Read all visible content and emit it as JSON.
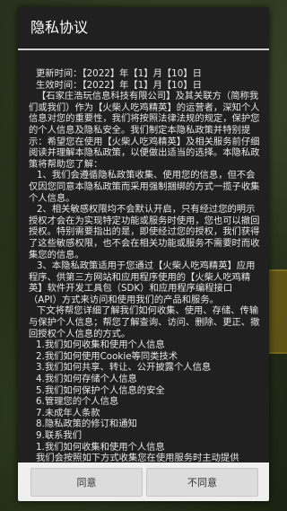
{
  "dialog": {
    "title": "隐私协议",
    "updated": "更新时间：【2022】年【1】月【10】日",
    "effective": "生效时间：【2022】年【1】月【10】日",
    "intro": "【石家庄浩玩信息科技有限公司】及其关联方（简称我们或我们）作为【火柴人吃鸡精英】的运营者，深知个人信息对您的重要性，我们将按照法律法规的规定，保护您的个人信息及隐私安全。我们制定本隐私政策并特别提示：希望您在使用【火柴人吃鸡精英】及相关服务前仔细阅读并理解本隐私政策，以便做出适当的选择。本隐私政策将帮助您了解：",
    "point1": "1、我们会遵循隐私政策收集、使用您的信息，但不会仅因您同意本隐私政策而采用强制捆绑的方式一揽子收集个人信息。",
    "point2": "2、相关敏感权限均不会默认开启，只有经过您的明示授权才会在为实现特定功能或服务时使用，您也可以撤回授权。特别需要指出的是，即使经过您的授权，我们获得了这些敏感权限，也不会在相关功能或服务不需要时而收集您的信息。",
    "point3": "3、本隐私政策适用于您通过【火柴人吃鸡精英】应用程序、供第三方网站和应用程序使用的【火柴人吃鸡精英】软件开发工具包（SDK）和应用程序编程接口（API）方式来访问和使用我们的产品和服务。",
    "toc_intro": "下文将帮您详细了解我们如何收集、使用、存储、传输与保护个人信息；帮您了解查询、访问、删除、更正、撤回授权个人信息的方式。",
    "toc": [
      "1.我们如何收集和使用个人信息",
      "2.我们如何使用Cookie等同类技术",
      "3.我们如何共享、转让、公开披露个人信息",
      "4.我们如何存储个人信息",
      "5.我们如何保护个人信息的安全",
      "6.管理您的个人信息",
      "7.未成年人条款",
      "8.隐私政策的修订和通知",
      "9.联系我们"
    ],
    "section1": "1.我们如何收集和使用个人信息",
    "cut_off": "我们会按照如下方式收集您在使用服务时主动提供"
  },
  "buttons": {
    "agree": "同意",
    "disagree": "不同意"
  }
}
